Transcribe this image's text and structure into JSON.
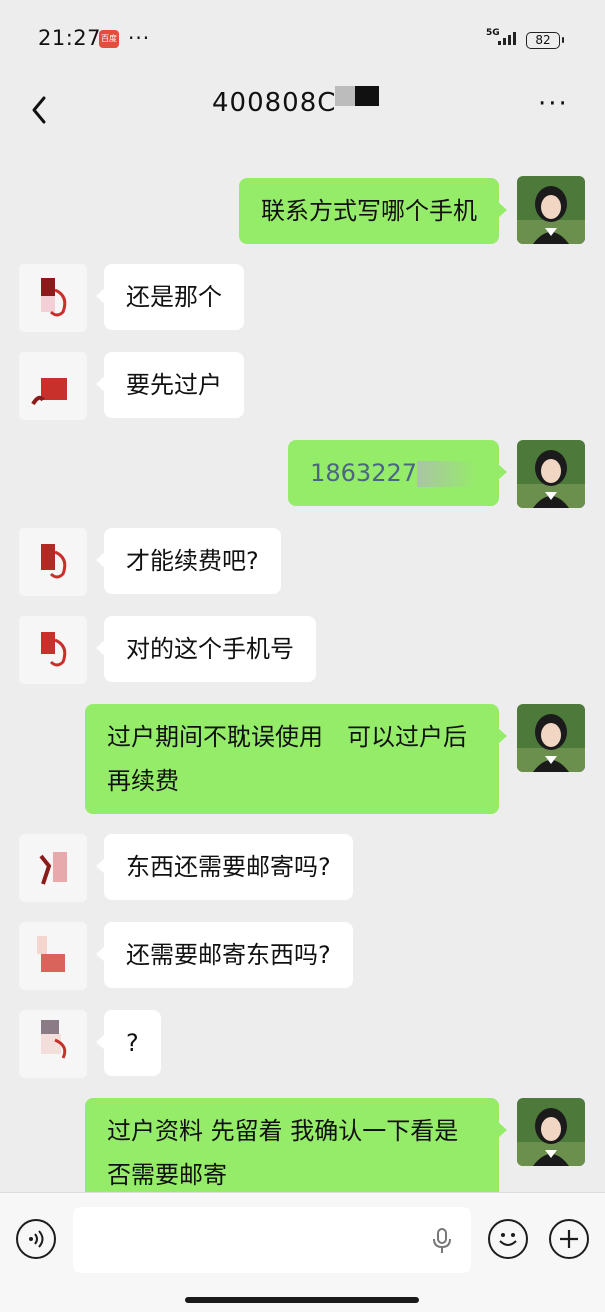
{
  "status_bar": {
    "time": "21:27",
    "app_badge": "百度",
    "dots": "···",
    "network": "5G",
    "battery": "82"
  },
  "nav": {
    "title": "400808C",
    "more": "···"
  },
  "messages": [
    {
      "from": "me",
      "text": "联系方式写哪个手机"
    },
    {
      "from": "other",
      "text": "还是那个"
    },
    {
      "from": "other",
      "text": "要先过户"
    },
    {
      "from": "me",
      "text": "1863227"
    },
    {
      "from": "other",
      "text": "才能续费吧?"
    },
    {
      "from": "other",
      "text": "对的这个手机号"
    },
    {
      "from": "me",
      "text": "过户期间不耽误使用　可以过户后再续费"
    },
    {
      "from": "other",
      "text": "东西还需要邮寄吗?"
    },
    {
      "from": "other",
      "text": "还需要邮寄东西吗?"
    },
    {
      "from": "other",
      "text": "?"
    },
    {
      "from": "me",
      "text": "过户资料 先留着 我确认一下看是否需要邮寄"
    }
  ],
  "colors": {
    "my_bubble": "#95ec69",
    "other_bubble": "#ffffff",
    "background": "#ededed"
  }
}
